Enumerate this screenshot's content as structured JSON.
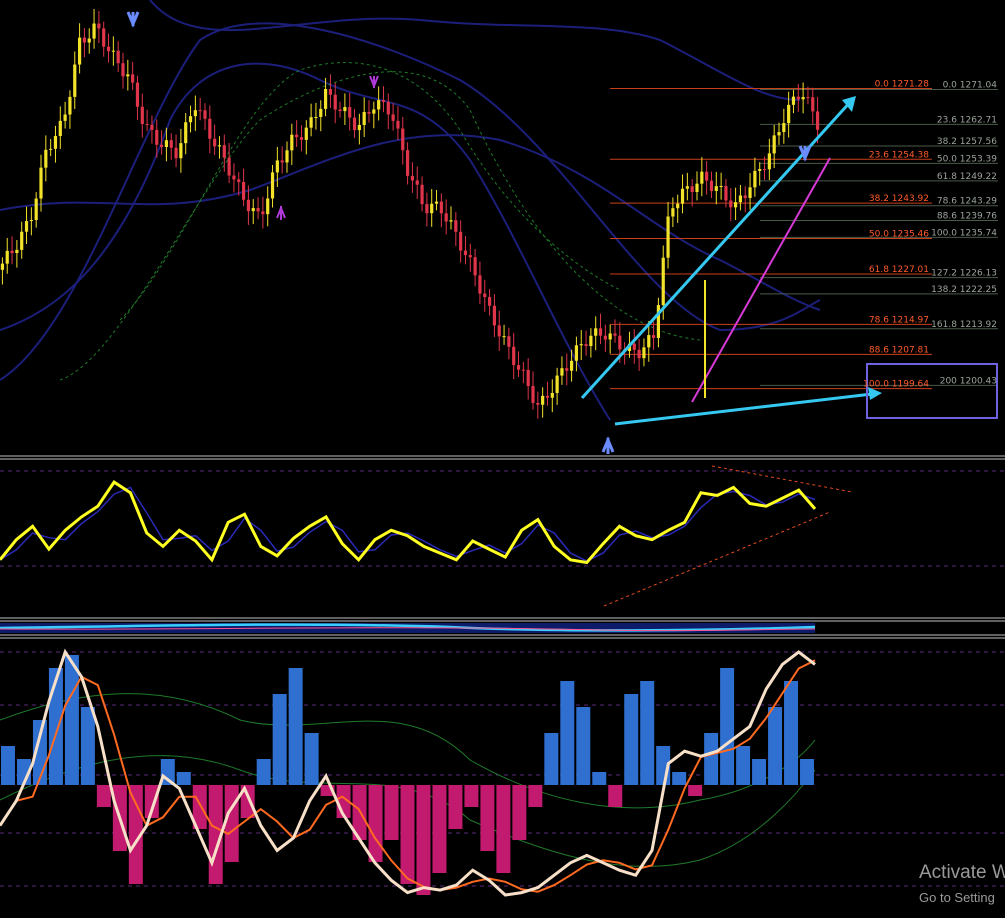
{
  "watermark": {
    "title": "Activate W",
    "subtitle": "Go to Setting"
  },
  "colors": {
    "background": "#000000",
    "bull": "#f2e22a",
    "bear": "#e0354a",
    "fib_left": "#ff5a2a",
    "fib_right": "#9aa39a",
    "trend": "#35c8f0",
    "channel": "#d83ad8",
    "bands": "#1c1f7a",
    "osc": "#ffff22",
    "hist_pos": "#2f6fd0",
    "hist_neg": "#c21a6e",
    "signal": "#ff6a20",
    "line_main": "#f8e0c8"
  },
  "chart_data": {
    "type": "candlestick",
    "panels": [
      "price",
      "oscillator",
      "volume-strip",
      "histogram"
    ],
    "fib_left": [
      {
        "level": "0.0",
        "price": "1271.28"
      },
      {
        "level": "23.6",
        "price": "1254.38"
      },
      {
        "level": "38.2",
        "price": "1243.92"
      },
      {
        "level": "50.0",
        "price": "1235.46"
      },
      {
        "level": "61.8",
        "price": "1227.01"
      },
      {
        "level": "78.6",
        "price": "1214.97"
      },
      {
        "level": "88.6",
        "price": "1207.81"
      },
      {
        "level": "100.0",
        "price": "1199.64"
      }
    ],
    "fib_right": [
      {
        "level": "0.0",
        "price": "1271.04"
      },
      {
        "level": "23.6",
        "price": "1262.71"
      },
      {
        "level": "38.2",
        "price": "1257.56"
      },
      {
        "level": "50.0",
        "price": "1253.39"
      },
      {
        "level": "61.8",
        "price": "1249.22"
      },
      {
        "level": "78.6",
        "price": "1243.29"
      },
      {
        "level": "88.6",
        "price": "1239.76"
      },
      {
        "level": "100.0",
        "price": "1235.74"
      },
      {
        "level": "127.2",
        "price": "1226.13"
      },
      {
        "level": "138.2",
        "price": "1222.25"
      },
      {
        "level": "161.8",
        "price": "1213.92"
      },
      {
        "level": "200",
        "price": "1200.43"
      }
    ],
    "price_path": [
      1228,
      1233,
      1240,
      1257,
      1263,
      1282,
      1286,
      1279,
      1274,
      1262,
      1258,
      1256,
      1268,
      1260,
      1253,
      1245,
      1240,
      1253,
      1259,
      1262,
      1270,
      1266,
      1262,
      1268,
      1266,
      1252,
      1243,
      1243,
      1236,
      1228,
      1218,
      1210,
      1203,
      1195,
      1201,
      1207,
      1212,
      1213,
      1210,
      1208,
      1212,
      1243,
      1247,
      1250,
      1247,
      1243,
      1249,
      1255,
      1265,
      1271,
      1263
    ],
    "osc_path": [
      30,
      45,
      55,
      38,
      52,
      62,
      70,
      88,
      80,
      50,
      40,
      52,
      44,
      30,
      58,
      64,
      40,
      33,
      46,
      55,
      62,
      42,
      30,
      45,
      52,
      48,
      40,
      35,
      30,
      44,
      38,
      32,
      52,
      60,
      40,
      30,
      28,
      42,
      55,
      48,
      45,
      52,
      58,
      80,
      78,
      84,
      72,
      70,
      76,
      82,
      68
    ],
    "hist_values": [
      0.3,
      0.2,
      0.5,
      0.9,
      1.0,
      0.6,
      -0.2,
      -0.6,
      -0.9,
      -0.3,
      0.2,
      0.1,
      -0.4,
      -0.9,
      -0.7,
      -0.3,
      0.2,
      0.7,
      0.9,
      0.4,
      -0.1,
      -0.3,
      -0.5,
      -0.7,
      -0.5,
      -0.9,
      -1.0,
      -0.8,
      -0.4,
      -0.2,
      -0.6,
      -0.8,
      -0.5,
      -0.2,
      0.4,
      0.8,
      0.6,
      0.1,
      -0.2,
      0.7,
      0.8,
      0.3,
      0.1,
      -0.1,
      0.4,
      0.9,
      0.3,
      0.2,
      0.6,
      0.8,
      0.2
    ],
    "line_path": [
      0.3,
      0.4,
      0.55,
      0.8,
      1.0,
      0.9,
      0.7,
      0.4,
      0.2,
      0.3,
      0.5,
      0.45,
      0.3,
      0.15,
      0.35,
      0.45,
      0.3,
      0.2,
      0.25,
      0.4,
      0.5,
      0.35,
      0.25,
      0.15,
      0.08,
      0.03,
      0.05,
      0.04,
      0.06,
      0.12,
      0.08,
      0.02,
      0.03,
      0.05,
      0.1,
      0.15,
      0.18,
      0.15,
      0.12,
      0.1,
      0.2,
      0.55,
      0.6,
      0.58,
      0.6,
      0.65,
      0.7,
      0.85,
      0.95,
      1.0,
      0.95
    ]
  }
}
